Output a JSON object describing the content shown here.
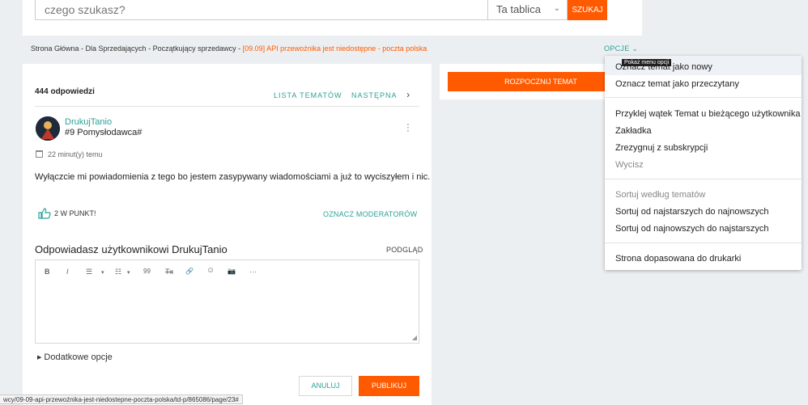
{
  "search": {
    "placeholder": "czego szukasz?",
    "scope": "Ta tablica",
    "button": "SZUKAJ"
  },
  "breadcrumb": {
    "path": "Strona Główna - Dla Sprzedających - Początkujący sprzedawcy - ",
    "current": "[09.09] API przewoźnika jest niedostępne - poczta polska"
  },
  "options": {
    "label": "OPCJE",
    "tooltip": "Pokaż menu opcji"
  },
  "thread": {
    "replies": "444 odpowiedzi",
    "topics_link": "LISTA TEMATÓW",
    "next_link": "NASTĘPNA"
  },
  "post": {
    "author": "DrukujTanio",
    "rank": "#9 Pomysłodawca#",
    "time": "22 minut(y) temu",
    "body": "Wyłączcie mi powiadomienia z tego bo jestem zasypywany wiadomościami a już to wyciszyłem i nic.",
    "kudos": "2 W PUNKT!",
    "notify_mods": "OZNACZ MODERATORÓW"
  },
  "reply": {
    "title": "Odpowiadasz użytkownikowi DrukujTanio",
    "preview": "PODGLĄD",
    "toolbar": [
      "B",
      "I",
      "☰",
      "▾",
      "☷",
      "▾",
      "99",
      "Tx",
      "🔗",
      "☺",
      "📷",
      "···"
    ],
    "extra": "Dodatkowe opcje",
    "cancel": "ANULUJ",
    "publish": "PUBLIKUJ"
  },
  "sidebar": {
    "new_topic": "ROZPOCZNIJ TEMAT"
  },
  "menu": {
    "items": [
      "Oznacz temat jako nowy",
      "Oznacz temat jako przeczytany",
      "Przyklej wątek Temat u bieżącego użytkownika",
      "Zakładka",
      "Zrezygnuj z subskrypcji",
      "Wycisz",
      "Sortuj według tematów",
      "Sortuj od najstarszych do najnowszych",
      "Sortuj od najnowszych do najstarszych",
      "Strona dopasowana do drukarki"
    ]
  },
  "status_url": "wcy/09-09-api-przewoźnika-jest-niedostepne-poczta-polska/td-p/865086/page/23#",
  "colors": {
    "accent": "#ff5a00",
    "link": "#2aa198"
  }
}
